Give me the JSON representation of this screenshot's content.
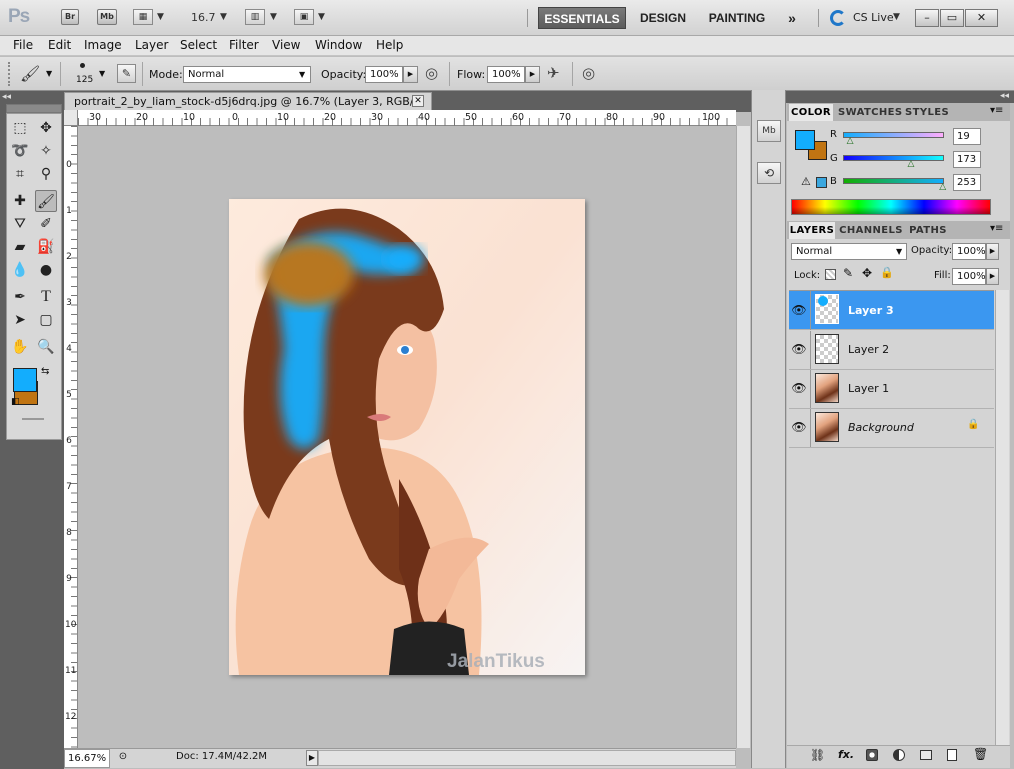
{
  "app": {
    "logo": "Ps",
    "bridge_label": "Br",
    "minibridge_label": "Mb",
    "zoom": "16.7",
    "workspaces": [
      "ESSENTIALS",
      "DESIGN",
      "PAINTING"
    ],
    "more": "»",
    "cslive": "CS Live",
    "window_controls": [
      "–",
      "▭",
      "✕"
    ]
  },
  "menu": [
    "File",
    "Edit",
    "Image",
    "Layer",
    "Select",
    "Filter",
    "View",
    "Window",
    "Help"
  ],
  "options": {
    "brush_size": "125",
    "mode_label": "Mode:",
    "mode_value": "Normal",
    "opacity_label": "Opacity:",
    "opacity_value": "100%",
    "flow_label": "Flow:",
    "flow_value": "100%"
  },
  "document": {
    "tab_title": "portrait_2_by_liam_stock-d5j6drq.jpg @ 16.7% (Layer 3, RGB/8) *",
    "ruler_h": [
      "30",
      "20",
      "10",
      "0",
      "10",
      "20",
      "30",
      "40",
      "50",
      "60",
      "70",
      "80",
      "90",
      "100"
    ],
    "ruler_v": [
      "0",
      "1",
      "2",
      "3",
      "4",
      "5",
      "6",
      "7",
      "8",
      "9",
      "10",
      "11",
      "12"
    ],
    "watermark": "JalanTikus"
  },
  "status": {
    "zoom": "16.67%",
    "doc": "Doc: 17.4M/42.2M"
  },
  "color_panel": {
    "tabs": [
      "COLOR",
      "SWATCHES",
      "STYLES"
    ],
    "channels": [
      {
        "label": "R",
        "value": "19",
        "level": 0.075
      },
      {
        "label": "G",
        "value": "173",
        "level": 0.678
      },
      {
        "label": "B",
        "value": "253",
        "level": 0.992
      }
    ],
    "foreground": "#13adfd",
    "background": "#c07412"
  },
  "layers_panel": {
    "tabs": [
      "LAYERS",
      "CHANNELS",
      "PATHS"
    ],
    "blend_mode": "Normal",
    "opacity_label": "Opacity:",
    "opacity_value": "100%",
    "lock_label": "Lock:",
    "fill_label": "Fill:",
    "fill_value": "100%",
    "layers": [
      {
        "name": "Layer 3",
        "selected": true
      },
      {
        "name": "Layer 2",
        "selected": false
      },
      {
        "name": "Layer 1",
        "selected": false
      },
      {
        "name": "Background",
        "selected": false
      }
    ],
    "footer_icons": [
      "link-icon",
      "fx-icon",
      "mask-icon",
      "adjustment-icon",
      "group-icon",
      "new-layer-icon",
      "trash-icon"
    ],
    "fx_label": "fx."
  },
  "colors": {
    "selection": "#3b97f0",
    "hair_blue": "#13adfd",
    "hair_orange": "#c07412"
  }
}
